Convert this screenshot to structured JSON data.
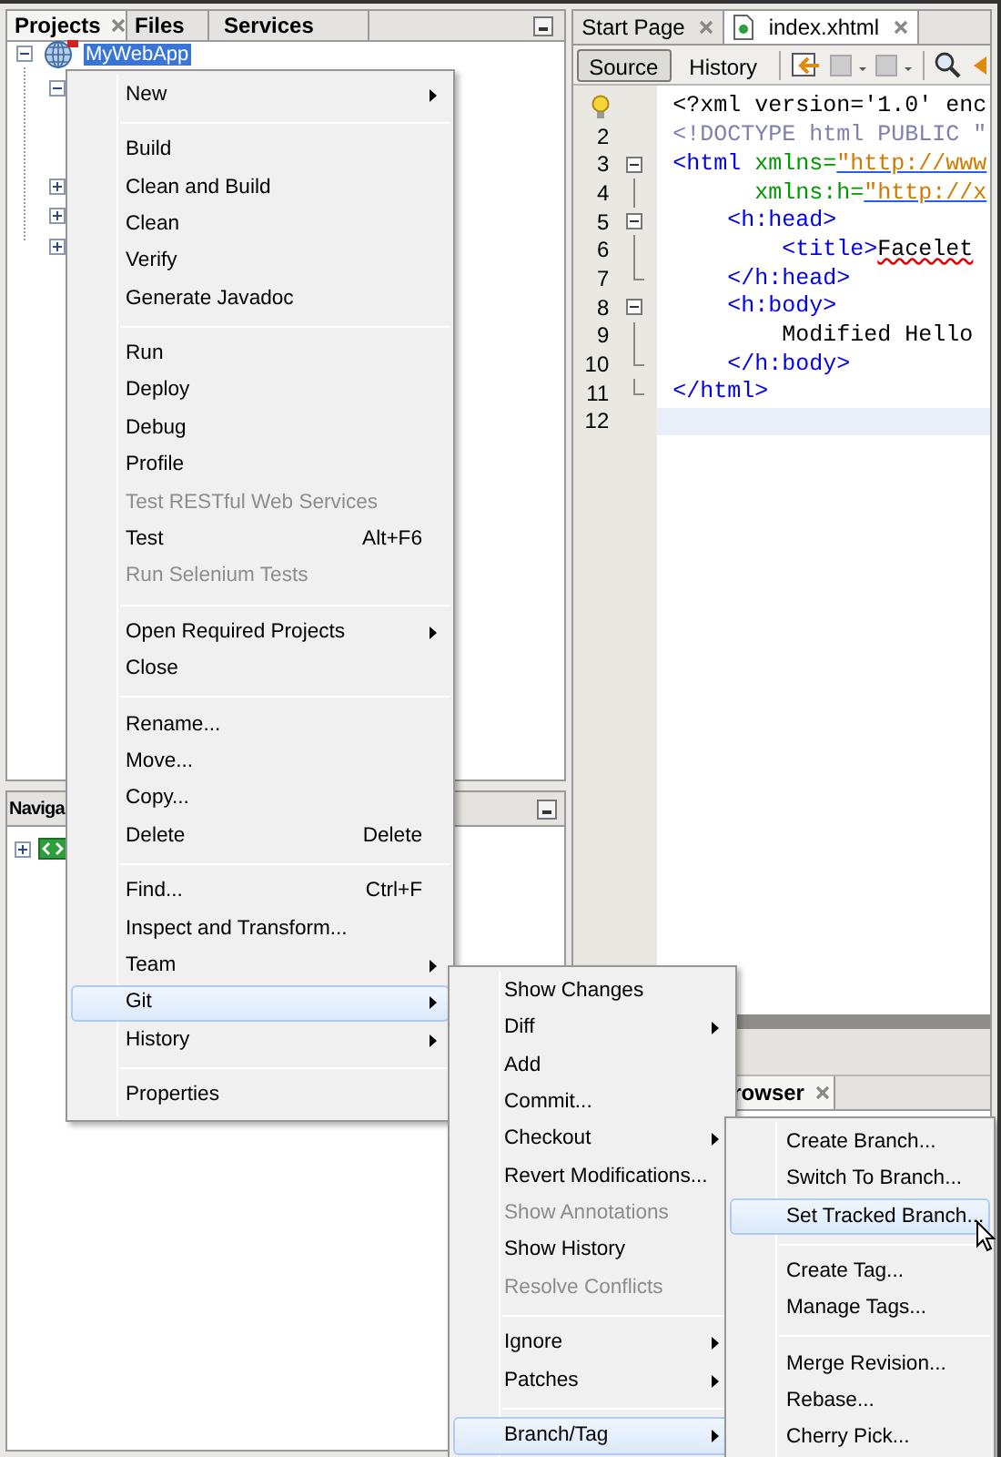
{
  "projects_panel": {
    "tabs": [
      {
        "label": "Projects",
        "selected": true,
        "closable": true
      },
      {
        "label": "Files",
        "selected": false,
        "closable": false
      },
      {
        "label": "Services",
        "selected": false,
        "closable": false
      }
    ],
    "tree": [
      {
        "label": "MyWebApp",
        "selected": true,
        "expanded": true,
        "children": [
          {
            "expanded": true
          },
          {
            "expanded": false
          },
          {
            "expanded": false
          },
          {
            "expanded": false
          }
        ]
      }
    ]
  },
  "navigator_panel": {
    "title": "Naviga",
    "tree": [
      {
        "expanded": false
      }
    ]
  },
  "editor": {
    "tabs": [
      {
        "label": "Start Page",
        "selected": false,
        "closable": true
      },
      {
        "label": "index.xhtml",
        "selected": true,
        "closable": true
      }
    ],
    "toolbar": [
      {
        "label": "Source",
        "selected": true
      },
      {
        "label": "History",
        "selected": false
      }
    ],
    "lines": [
      {
        "kind": "hint",
        "current": false,
        "segments": [
          {
            "kind": "text",
            "text": "<?xml version='1.0' enc"
          }
        ]
      },
      {
        "kind": "numbered",
        "number": "2",
        "current": false,
        "segments": [
          {
            "kind": "doctype",
            "text": "<!DOCTYPE html PUBLIC \""
          }
        ]
      },
      {
        "kind": "numbered",
        "number": "3",
        "current": false,
        "fold": {
          "kind": "start"
        },
        "segments": [
          {
            "kind": "tag",
            "text": "<html "
          },
          {
            "kind": "attr",
            "text": "xmlns="
          },
          {
            "kind": "string",
            "text": "\"http://www"
          }
        ]
      },
      {
        "kind": "numbered",
        "number": "4",
        "current": false,
        "fold": {
          "kind": "inner"
        },
        "segments": [
          {
            "kind": "attr",
            "text": "      xmlns:h="
          },
          {
            "kind": "string",
            "text": "\"http://x"
          }
        ]
      },
      {
        "kind": "numbered",
        "number": "5",
        "current": false,
        "fold": {
          "kind": "start"
        },
        "segments": [
          {
            "kind": "tag",
            "text": "    <h:head>"
          }
        ]
      },
      {
        "kind": "numbered",
        "number": "6",
        "current": false,
        "fold": {
          "kind": "inner"
        },
        "segments": [
          {
            "kind": "tag",
            "text": "        <title>"
          },
          {
            "kind": "error",
            "text": "Facelet"
          }
        ]
      },
      {
        "kind": "numbered",
        "number": "7",
        "current": false,
        "fold": {
          "kind": "end"
        },
        "segments": [
          {
            "kind": "tag",
            "text": "    </h:head>"
          }
        ]
      },
      {
        "kind": "numbered",
        "number": "8",
        "current": false,
        "fold": {
          "kind": "start"
        },
        "segments": [
          {
            "kind": "tag",
            "text": "    <h:body>"
          }
        ]
      },
      {
        "kind": "numbered",
        "number": "9",
        "current": false,
        "fold": {
          "kind": "inner"
        },
        "segments": [
          {
            "kind": "text",
            "text": "        Modified Hello"
          }
        ]
      },
      {
        "kind": "numbered",
        "number": "10",
        "current": false,
        "fold": {
          "kind": "end"
        },
        "segments": [
          {
            "kind": "tag",
            "text": "    </h:body>"
          }
        ]
      },
      {
        "kind": "numbered",
        "number": "11",
        "current": false,
        "fold": {
          "kind": "end"
        },
        "segments": [
          {
            "kind": "tag",
            "text": "</html>"
          }
        ]
      },
      {
        "kind": "numbered",
        "number": "12",
        "current": true
      }
    ]
  },
  "browser_panel": {
    "tab": "rowser"
  },
  "context_menu": {
    "items": [
      {
        "kind": "item",
        "label": "New",
        "submenu": true,
        "disabled": false,
        "selected": false
      },
      {
        "kind": "separator"
      },
      {
        "kind": "item",
        "label": "Build",
        "submenu": false,
        "disabled": false,
        "selected": false
      },
      {
        "kind": "item",
        "label": "Clean and Build",
        "submenu": false,
        "disabled": false,
        "selected": false
      },
      {
        "kind": "item",
        "label": "Clean",
        "submenu": false,
        "disabled": false,
        "selected": false
      },
      {
        "kind": "item",
        "label": "Verify",
        "submenu": false,
        "disabled": false,
        "selected": false
      },
      {
        "kind": "item",
        "label": "Generate Javadoc",
        "submenu": false,
        "disabled": false,
        "selected": false
      },
      {
        "kind": "separator"
      },
      {
        "kind": "item",
        "label": "Run",
        "submenu": false,
        "disabled": false,
        "selected": false
      },
      {
        "kind": "item",
        "label": "Deploy",
        "submenu": false,
        "disabled": false,
        "selected": false
      },
      {
        "kind": "item",
        "label": "Debug",
        "submenu": false,
        "disabled": false,
        "selected": false
      },
      {
        "kind": "item",
        "label": "Profile",
        "submenu": false,
        "disabled": false,
        "selected": false
      },
      {
        "kind": "item",
        "label": "Test RESTful Web Services",
        "submenu": false,
        "disabled": true,
        "selected": false
      },
      {
        "kind": "item",
        "label": "Test",
        "shortcut": "Alt+F6",
        "submenu": false,
        "disabled": false,
        "selected": false
      },
      {
        "kind": "item",
        "label": "Run Selenium Tests",
        "submenu": false,
        "disabled": true,
        "selected": false
      },
      {
        "kind": "separator"
      },
      {
        "kind": "item",
        "label": "Open Required Projects",
        "submenu": true,
        "disabled": false,
        "selected": false
      },
      {
        "kind": "item",
        "label": "Close",
        "submenu": false,
        "disabled": false,
        "selected": false
      },
      {
        "kind": "separator"
      },
      {
        "kind": "item",
        "label": "Rename...",
        "submenu": false,
        "disabled": false,
        "selected": false
      },
      {
        "kind": "item",
        "label": "Move...",
        "submenu": false,
        "disabled": false,
        "selected": false
      },
      {
        "kind": "item",
        "label": "Copy...",
        "submenu": false,
        "disabled": false,
        "selected": false
      },
      {
        "kind": "item",
        "label": "Delete",
        "shortcut": "Delete",
        "submenu": false,
        "disabled": false,
        "selected": false
      },
      {
        "kind": "separator"
      },
      {
        "kind": "item",
        "label": "Find...",
        "shortcut": "Ctrl+F",
        "submenu": false,
        "disabled": false,
        "selected": false
      },
      {
        "kind": "item",
        "label": "Inspect and Transform...",
        "submenu": false,
        "disabled": false,
        "selected": false
      },
      {
        "kind": "item",
        "label": "Team",
        "submenu": true,
        "disabled": false,
        "selected": false
      },
      {
        "kind": "item",
        "label": "Git",
        "submenu": true,
        "disabled": false,
        "selected": true
      },
      {
        "kind": "item",
        "label": "History",
        "submenu": true,
        "disabled": false,
        "selected": false
      },
      {
        "kind": "separator"
      },
      {
        "kind": "item",
        "label": "Properties",
        "submenu": false,
        "disabled": false,
        "selected": false
      }
    ]
  },
  "git_menu": {
    "items": [
      {
        "kind": "item",
        "label": "Show Changes",
        "submenu": false,
        "disabled": false,
        "selected": false
      },
      {
        "kind": "item",
        "label": "Diff",
        "submenu": true,
        "disabled": false,
        "selected": false
      },
      {
        "kind": "item",
        "label": "Add",
        "submenu": false,
        "disabled": false,
        "selected": false
      },
      {
        "kind": "item",
        "label": "Commit...",
        "submenu": false,
        "disabled": false,
        "selected": false
      },
      {
        "kind": "item",
        "label": "Checkout",
        "submenu": true,
        "disabled": false,
        "selected": false
      },
      {
        "kind": "item",
        "label": "Revert Modifications...",
        "submenu": false,
        "disabled": false,
        "selected": false
      },
      {
        "kind": "item",
        "label": "Show Annotations",
        "submenu": false,
        "disabled": true,
        "selected": false
      },
      {
        "kind": "item",
        "label": "Show History",
        "submenu": false,
        "disabled": false,
        "selected": false
      },
      {
        "kind": "item",
        "label": "Resolve Conflicts",
        "submenu": false,
        "disabled": true,
        "selected": false
      },
      {
        "kind": "separator"
      },
      {
        "kind": "item",
        "label": "Ignore",
        "submenu": true,
        "disabled": false,
        "selected": false
      },
      {
        "kind": "item",
        "label": "Patches",
        "submenu": true,
        "disabled": false,
        "selected": false
      },
      {
        "kind": "separator"
      },
      {
        "kind": "item",
        "label": "Branch/Tag",
        "submenu": true,
        "disabled": false,
        "selected": true
      }
    ]
  },
  "branch_tag_menu": {
    "items": [
      {
        "kind": "item",
        "label": "Create Branch...",
        "submenu": false,
        "disabled": false,
        "selected": false
      },
      {
        "kind": "item",
        "label": "Switch To Branch...",
        "submenu": false,
        "disabled": false,
        "selected": false
      },
      {
        "kind": "item",
        "label": "Set Tracked Branch...",
        "submenu": false,
        "disabled": false,
        "selected": true
      },
      {
        "kind": "separator"
      },
      {
        "kind": "item",
        "label": "Create Tag...",
        "submenu": false,
        "disabled": false,
        "selected": false
      },
      {
        "kind": "item",
        "label": "Manage Tags...",
        "submenu": false,
        "disabled": false,
        "selected": false
      },
      {
        "kind": "separator"
      },
      {
        "kind": "item",
        "label": "Merge Revision...",
        "submenu": false,
        "disabled": false,
        "selected": false
      },
      {
        "kind": "item",
        "label": "Rebase...",
        "submenu": false,
        "disabled": false,
        "selected": false
      },
      {
        "kind": "item",
        "label": "Cherry Pick...",
        "submenu": false,
        "disabled": false,
        "selected": false
      }
    ]
  }
}
